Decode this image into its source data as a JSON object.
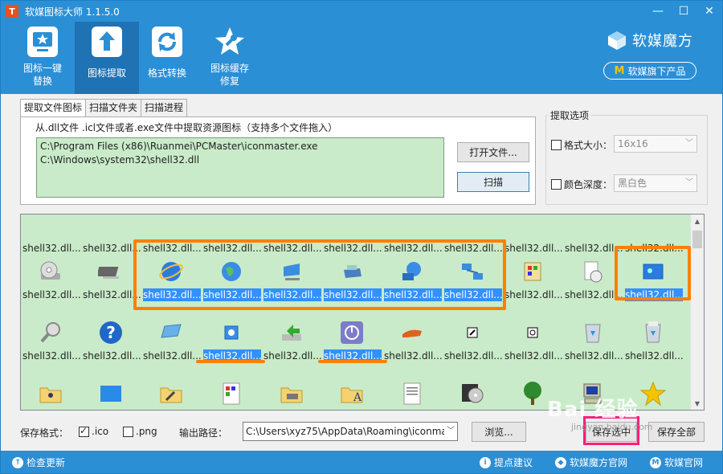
{
  "window": {
    "title": "软媒图标大师 1.1.5.0",
    "logo_text": "T",
    "min": "—",
    "max": "☐",
    "close": "✕"
  },
  "toolbar": {
    "items": [
      {
        "label": "图标一键\n替换",
        "icon": "star-tile-icon"
      },
      {
        "label": "图标提取",
        "icon": "upload-arrow-icon"
      },
      {
        "label": "格式转换",
        "icon": "refresh-icon"
      },
      {
        "label": "图标缓存\n修复",
        "icon": "wrench-star-icon"
      }
    ],
    "brand_name": "软媒魔方",
    "brand_button": "软媒旗下产品",
    "brand_button_mark": "M"
  },
  "tabs": [
    "提取文件图标",
    "扫描文件夹",
    "扫描进程"
  ],
  "extract": {
    "hint": "从.dll文件 .icl文件或者.exe文件中提取资源图标（支持多个文件拖入）",
    "paths": [
      "C:\\Program Files (x86)\\Ruanmei\\PCMaster\\iconmaster.exe",
      "C:\\Windows\\system32\\shell32.dll"
    ],
    "open_button": "打开文件...",
    "scan_button": "扫描"
  },
  "options": {
    "title": "提取选项",
    "size_label": "格式大小：",
    "size_value": "16x16",
    "depth_label": "颜色深度：",
    "depth_value": "黑白色"
  },
  "grid": {
    "label": "shell32.dll...",
    "rows": [
      {
        "icons": [
          "blank",
          "blank",
          "blank",
          "blank",
          "blank",
          "blank",
          "blank",
          "blank",
          "blank",
          "blank",
          "blank"
        ],
        "selected": []
      },
      {
        "icons": [
          "cd-drive-icon",
          "chip-icon",
          "ie-globe-icon",
          "globe-icon",
          "monitor-icon",
          "printer-icon",
          "network-globe-icon",
          "network-computers-icon",
          "control-panel-icon",
          "clock-page-icon",
          "blue-window-icon"
        ],
        "selected": [
          2,
          3,
          4,
          5,
          6,
          7,
          10
        ]
      },
      {
        "icons": [
          "magnifier-icon",
          "help-icon",
          "tray-icon",
          "speaker-icon",
          "arrow-drive-icon",
          "power-icon",
          "hand-icon",
          "shortcut-icon",
          "shortcut-power-icon",
          "recycle-bin-empty-icon",
          "recycle-bin-full-icon"
        ],
        "selected": [
          3,
          5
        ]
      },
      {
        "icons": [
          "folder-people-icon",
          "blue-square-icon",
          "folder-tools-icon",
          "colorful-doc-icon",
          "printer-folder-icon",
          "font-folder-icon",
          "text-doc-icon",
          "cd-media-icon",
          "tree-icon",
          "computer-icon",
          "star-icon"
        ],
        "selected": []
      }
    ]
  },
  "bottom": {
    "save_format_label": "保存格式：",
    "ico_label": ".ico",
    "png_label": ".png",
    "output_label": "输出路径：",
    "output_path": "C:\\Users\\xyz75\\AppData\\Roaming\\iconma",
    "browse_button": "浏览...",
    "save_selected_button": "保存选中",
    "save_all_button": "保存全部"
  },
  "watermark": {
    "text": "Bai 经验",
    "sub": "jingyan.baidu.com"
  },
  "status": {
    "update": "检查更新",
    "suggest": "提点建议",
    "mofang_site": "软媒魔方官网",
    "official_site": "软媒官网"
  }
}
